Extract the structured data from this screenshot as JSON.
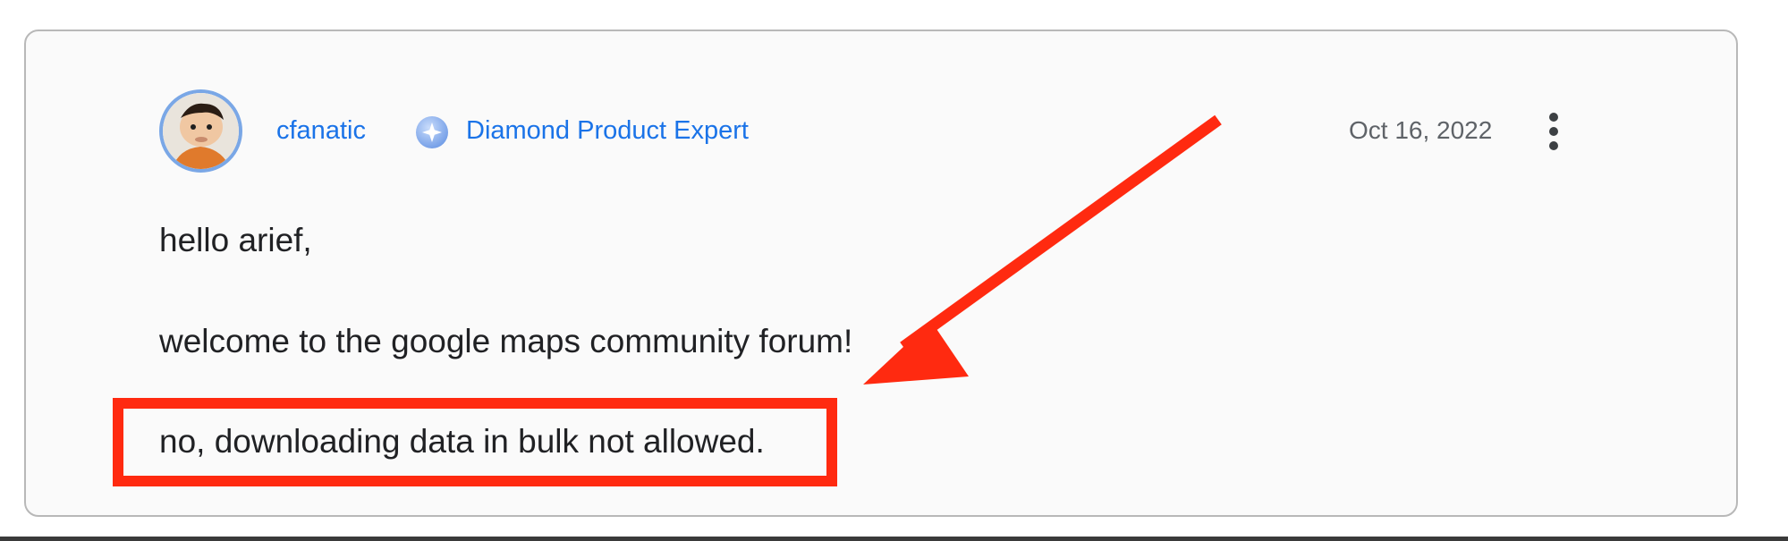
{
  "post": {
    "author": {
      "name": "cfanatic",
      "badge_label": "Diamond Product Expert",
      "badge_icon": "diamond-star-icon",
      "avatar": "avatar-image"
    },
    "date": "Oct 16, 2022",
    "menu_icon": "more-vert-icon",
    "body": [
      "hello arief,",
      "welcome to the google maps community forum!",
      "no, downloading data in bulk not allowed."
    ]
  },
  "annotation": {
    "highlight_color": "#ff2a10",
    "arrow_color": "#ff2a10"
  },
  "colors": {
    "link": "#1a73e8",
    "text": "#202124",
    "muted": "#5f6368"
  }
}
